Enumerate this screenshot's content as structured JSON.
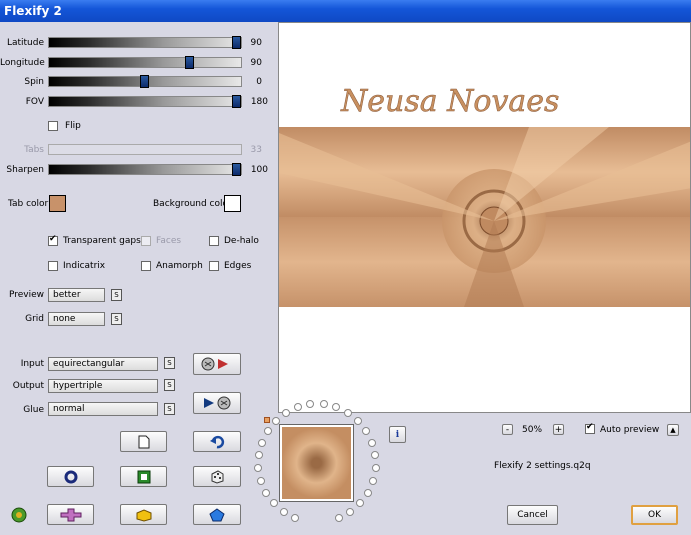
{
  "window": {
    "title": "Flexify 2"
  },
  "sliders": [
    {
      "id": "latitude",
      "label": "Latitude",
      "value": "90",
      "level": 1.0,
      "disabled": false
    },
    {
      "id": "longitude",
      "label": "Longitude",
      "value": "90",
      "level": 0.72,
      "disabled": false
    },
    {
      "id": "spin",
      "label": "Spin",
      "value": "0",
      "level": 0.5,
      "disabled": false
    },
    {
      "id": "fov",
      "label": "FOV",
      "value": "180",
      "level": 1.0,
      "disabled": false
    }
  ],
  "flip": {
    "label": "Flip",
    "checked": false
  },
  "tabs": {
    "label": "Tabs",
    "value": "33",
    "disabled": true
  },
  "sharpen": {
    "label": "Sharpen",
    "value": "100",
    "level": 1.0
  },
  "colors": {
    "tab_color_label": "Tab color",
    "tab_color": "#c8926a",
    "background_color_label": "Background color",
    "background_color": "#ffffff"
  },
  "options": [
    {
      "id": "transparent-gaps",
      "label": "Transparent gaps",
      "checked": true,
      "disabled": false
    },
    {
      "id": "faces",
      "label": "Faces",
      "checked": false,
      "disabled": true
    },
    {
      "id": "de-halo",
      "label": "De-halo",
      "checked": false,
      "disabled": false
    },
    {
      "id": "indicatrix",
      "label": "Indicatrix",
      "checked": false,
      "disabled": false
    },
    {
      "id": "anamorph",
      "label": "Anamorph",
      "checked": false,
      "disabled": false
    },
    {
      "id": "edges",
      "label": "Edges",
      "checked": false,
      "disabled": false
    }
  ],
  "preview_mode": {
    "label": "Preview",
    "value": "better"
  },
  "grid": {
    "label": "Grid",
    "value": "none"
  },
  "input": {
    "label": "Input",
    "value": "equirectangular"
  },
  "output": {
    "label": "Output",
    "value": "hypertriple"
  },
  "glue": {
    "label": "Glue",
    "value": "normal"
  },
  "zoom": {
    "minus": "-",
    "value": "50%",
    "plus": "+"
  },
  "auto_preview": {
    "label": "Auto preview",
    "checked": true
  },
  "settings_file": "Flexify 2 settings.q2q",
  "buttons": {
    "cancel": "Cancel",
    "ok": "OK",
    "info": "i",
    "s": "S",
    "up": "▲"
  },
  "watermark": "Neusa Novaes",
  "accent_color": "#d6a06a"
}
